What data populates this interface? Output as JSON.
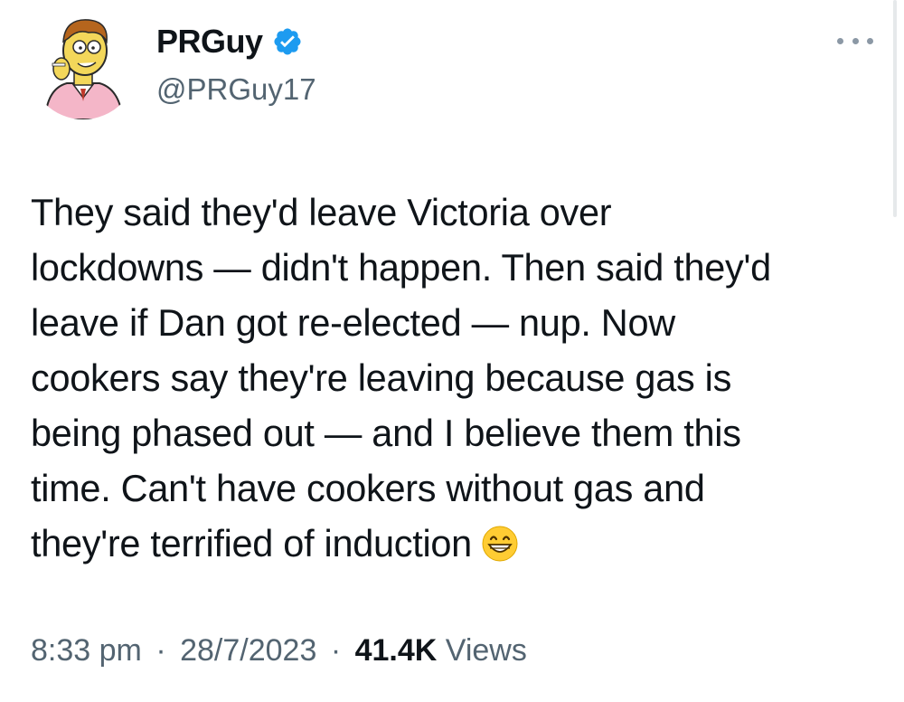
{
  "author": {
    "display_name": "PRGuy",
    "handle": "@PRGuy17",
    "verified": true,
    "avatar_icon": "cartoon-avatar-icon",
    "verified_icon": "verified-badge-icon"
  },
  "more_icon": "more-options-icon",
  "tweet": {
    "lines": [
      "They said they'd leave Victoria over",
      "lockdowns — didn't happen. Then said they'd",
      "leave if Dan got re-elected — nup. Now",
      "cookers say they're leaving because gas is",
      "being phased out — and I believe them this",
      "time. Can't have cookers without gas and",
      "they're terrified of induction"
    ],
    "emoji": "grinning-face-emoji"
  },
  "meta": {
    "time": "8:33 pm",
    "separator": "·",
    "date": "28/7/2023",
    "views_count": "41.4K",
    "views_label": "Views"
  },
  "colors": {
    "text_primary": "#0f1419",
    "text_secondary": "#536471",
    "verified_blue": "#1d9bf0"
  }
}
